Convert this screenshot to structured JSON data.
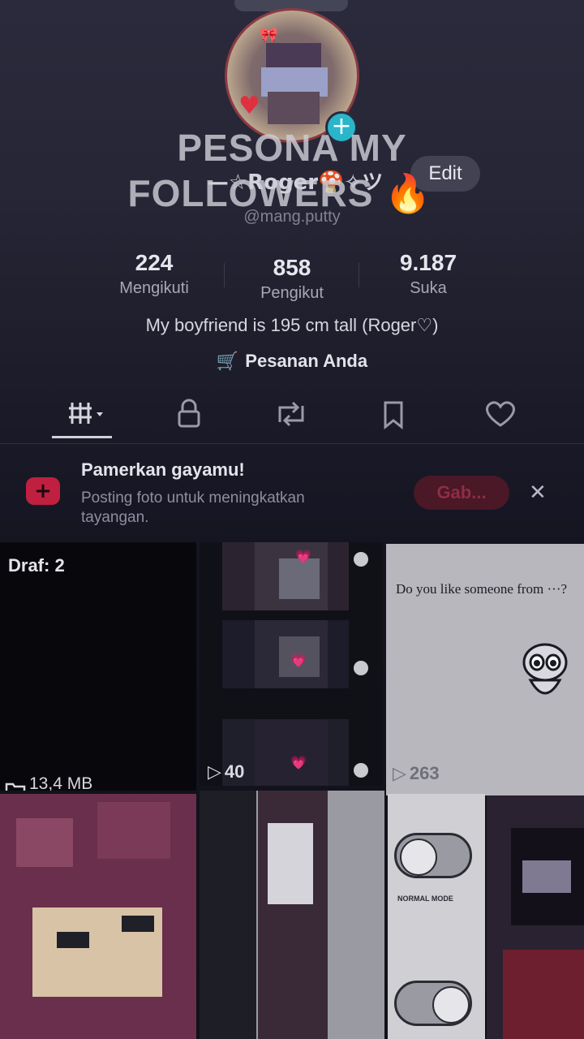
{
  "overlay": {
    "title_line1": "PESONA MY",
    "title_line2": "FOLLOWERS",
    "emoji": "🔥"
  },
  "profile": {
    "display_name": "—☆Roger🍄✧ツ",
    "username": "@mang.putty",
    "edit_label": "Edit",
    "bio": "My boyfriend is 195 cm tall (Roger♡)",
    "orders_label": "Pesanan Anda"
  },
  "stats": [
    {
      "value": "224",
      "label": "Mengikuti"
    },
    {
      "value": "858",
      "label": "Pengikut"
    },
    {
      "value": "9.187",
      "label": "Suka"
    }
  ],
  "banner": {
    "title": "Pamerkan gayamu!",
    "text": "Posting foto untuk meningkatkan tayangan.",
    "button_label": "Gab..."
  },
  "grid": {
    "draft_label": "Draf: 2",
    "draft_size": "13,4 MB",
    "video1_views": "40",
    "video2_caption": "Do you like someone from ···?",
    "video2_views": "263",
    "normal_mode_label": "NORMAL MODE"
  },
  "colors": {
    "accent": "#e03a5e",
    "avatar_add": "#2ab5c9"
  },
  "icons": {
    "tab_grid": "grid-icon",
    "tab_private": "lock-icon",
    "tab_repost": "repost-icon",
    "tab_saved": "bookmark-icon",
    "tab_liked": "heart-icon"
  }
}
